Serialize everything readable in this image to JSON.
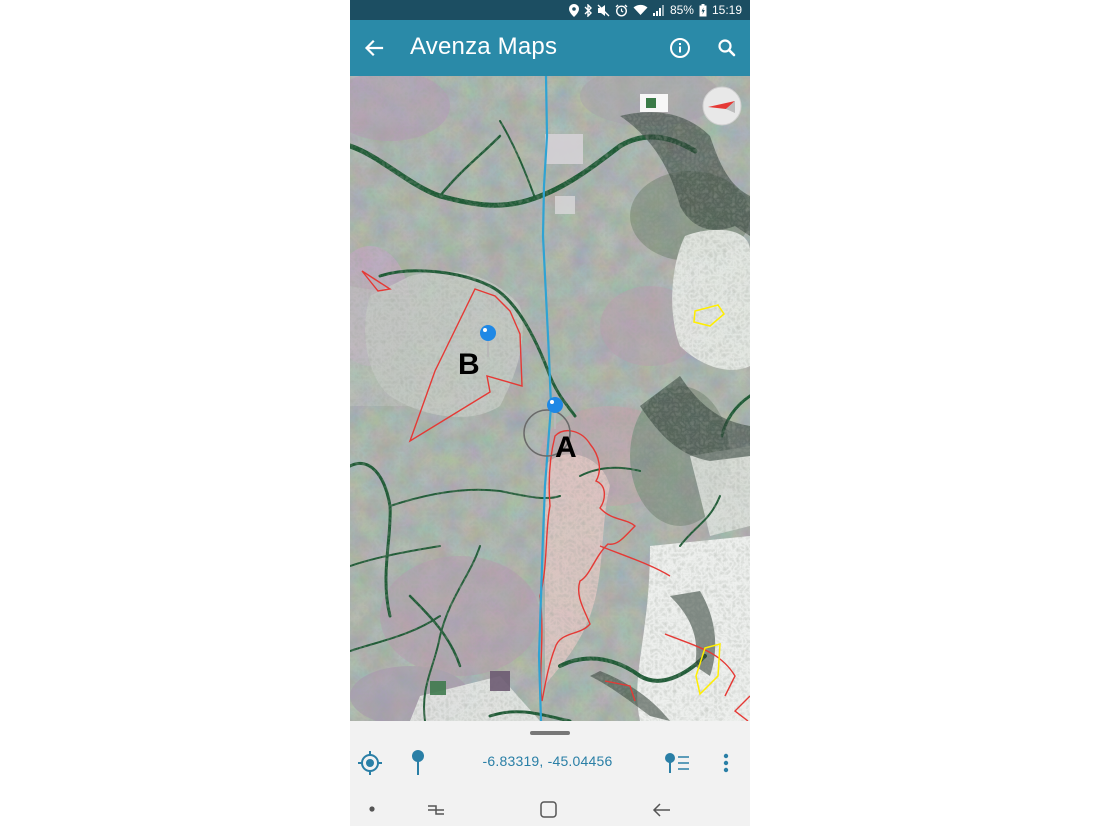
{
  "status_bar": {
    "battery_percent": "85%",
    "time": "15:19",
    "icons": [
      "location-icon",
      "bluetooth-icon",
      "mute-icon",
      "alarm-icon",
      "wifi-icon",
      "signal-icon",
      "battery-icon"
    ]
  },
  "app_bar": {
    "title": "Avenza Maps",
    "back_icon": "arrow-back-icon",
    "info_icon": "info-icon",
    "search_icon": "search-icon",
    "color": "#2a8aa8"
  },
  "map": {
    "labels": {
      "a": "A",
      "b": "B"
    },
    "pins": [
      "pin-a",
      "pin-b"
    ],
    "compass_icon": "compass-icon",
    "track_color": "#2fa3d3",
    "boundary_color": "#e53935",
    "highlight_color": "#ffee00"
  },
  "bottom_bar": {
    "coordinates": "-6.83319, -45.04456",
    "locate_icon": "gps-locate-icon",
    "pin_icon": "drop-pin-icon",
    "pin_list_icon": "pin-list-icon",
    "more_icon": "more-vert-icon",
    "accent_color": "#2a7fa6"
  },
  "nav_bar": {
    "icons": [
      "nav-dot-icon",
      "recents-icon",
      "home-icon",
      "back-icon"
    ]
  }
}
